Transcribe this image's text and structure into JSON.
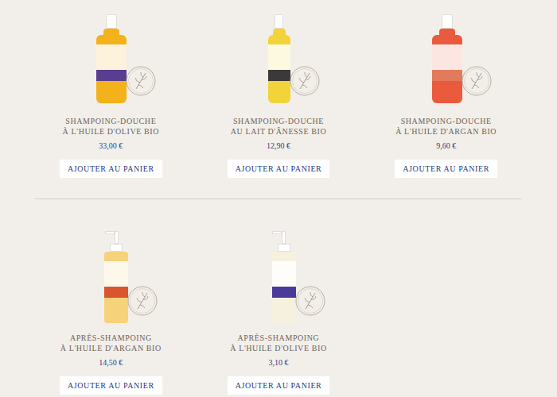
{
  "products": [
    {
      "title": [
        "SHAMPOING-DOUCHE",
        "À L'HUILE D'OLIVE BIO"
      ],
      "price": "33,00 €",
      "button": "AJOUTER AU PANIER",
      "kind": "bottle",
      "color": "#f3b21a",
      "label_color": "#5a3d91"
    },
    {
      "title": [
        "SHAMPOING-DOUCHE",
        "AU LAIT D'ÂNESSE BIO"
      ],
      "price": "12,90 €",
      "button": "AJOUTER AU PANIER",
      "kind": "slim-bottle",
      "color": "#f2d43a",
      "label_color": "#3a3a3a"
    },
    {
      "title": [
        "SHAMPOING-DOUCHE",
        "À L'HUILE D'ARGAN BIO"
      ],
      "price": "9,60 €",
      "button": "AJOUTER AU PANIER",
      "kind": "bottle",
      "color": "#ea5a3c",
      "label_color": "#e27a5c"
    },
    {
      "title": [
        "APRÈS-SHAMPOING",
        "À L'HUILE D'ARGAN BIO"
      ],
      "price": "14,50 €",
      "button": "AJOUTER AU PANIER",
      "kind": "pump",
      "color": "#f6d27a",
      "label_color": "#d9552f"
    },
    {
      "title": [
        "APRÈS-SHAMPOING",
        "À L'HUILE D'OLIVE BIO"
      ],
      "price": "3,10 €",
      "button": "AJOUTER AU PANIER",
      "kind": "pump",
      "color": "#f6f1de",
      "label_color": "#4b3a9a"
    }
  ]
}
